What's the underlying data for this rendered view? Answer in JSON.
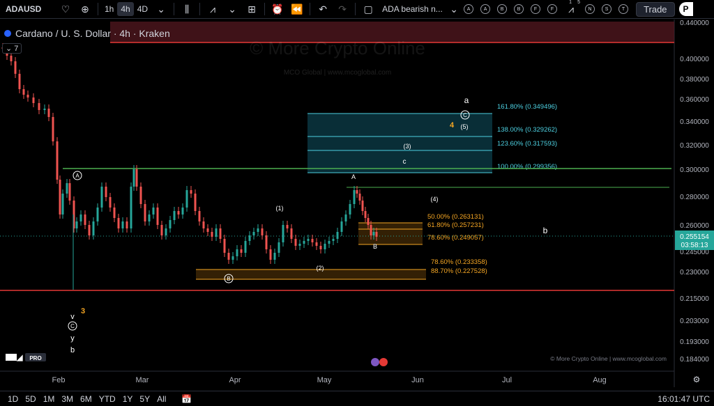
{
  "toolbar": {
    "symbol": "ADAUSD",
    "timeframes": [
      "1h",
      "4h",
      "4D"
    ],
    "active_timeframe": "4h",
    "layout_name": "ADA bearish n...",
    "alert_buttons": [
      "A",
      "A",
      "B",
      "B",
      "F",
      "F"
    ],
    "extra_buttons": [
      "N",
      "S",
      "T"
    ],
    "counter_top": "1",
    "counter_right": "5",
    "trade_label": "Trade",
    "publish_label": "P"
  },
  "legend": {
    "title": "Cardano / U. S. Dollar · 4h · Kraken",
    "collapse_count": "7"
  },
  "watermark": {
    "main": "© More Crypto Online",
    "sub": "MCO Global  |  www.mcoglobal.com",
    "footer": "© More Crypto Online   |   www.mcoglobal.com"
  },
  "price_axis": {
    "labels": [
      "0.440000",
      "0.400000",
      "0.380000",
      "0.360000",
      "0.340000",
      "0.320000",
      "0.300000",
      "0.280000",
      "0.260000",
      "0.245000",
      "0.230000",
      "0.215000",
      "0.203000",
      "0.193000",
      "0.184000"
    ],
    "current_price": "0.255154",
    "countdown": "03:58:13",
    "current_color": "#26a69a"
  },
  "time_axis": {
    "labels": [
      "Feb",
      "Mar",
      "Apr",
      "May",
      "Jun",
      "Jul",
      "Aug"
    ]
  },
  "fib_extension": {
    "levels": [
      "161.80% (0.349496)",
      "138.00% (0.329262)",
      "123.60% (0.317593)",
      "100.00% (0.299356)"
    ],
    "color": "#4dd0e1"
  },
  "fib_retrace_upper": {
    "levels": [
      "50.00% (0.263131)",
      "61.80% (0.257231)",
      "78.60% (0.249057)"
    ],
    "color": "#f5a623"
  },
  "fib_retrace_lower": {
    "levels": [
      "78.60% (0.233358)",
      "88.70% (0.227528)"
    ],
    "color": "#f5a623"
  },
  "wave_labels": {
    "a_top": "a",
    "c_circle": "C",
    "four_orange": "4",
    "five": "(5)",
    "three": "(3)",
    "c_small": "c",
    "A_small": "A",
    "four_paren": "(4)",
    "one": "(1)",
    "two": "(2)",
    "B_small": "B",
    "A_circle": "A",
    "B_circle": "B",
    "b_right": "b",
    "v": "v",
    "three_orange": "3",
    "C_circle_low": "C",
    "y": "y",
    "b_low": "b"
  },
  "bottom": {
    "ranges": [
      "1D",
      "5D",
      "1M",
      "3M",
      "6M",
      "YTD",
      "1Y",
      "5Y",
      "All"
    ],
    "clock": "16:01:47 UTC"
  }
}
